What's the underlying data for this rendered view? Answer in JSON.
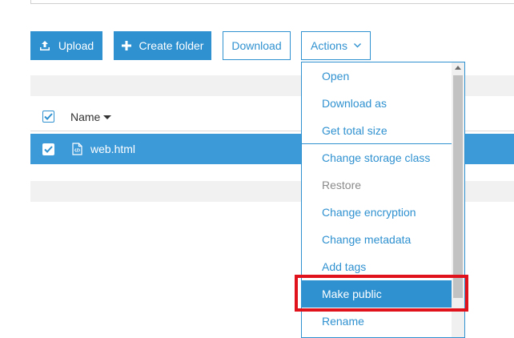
{
  "toolbar": {
    "upload_label": "Upload",
    "create_folder_label": "Create folder",
    "download_label": "Download",
    "actions_label": "Actions"
  },
  "table": {
    "name_header": "Name",
    "rows": [
      {
        "name": "web.html",
        "selected": true
      }
    ]
  },
  "actions_menu": {
    "items": [
      {
        "label": "Open"
      },
      {
        "label": "Download as"
      },
      {
        "label": "Get total size"
      },
      {
        "label": "Change storage class"
      },
      {
        "label": "Restore",
        "disabled": true
      },
      {
        "label": "Change encryption"
      },
      {
        "label": "Change metadata"
      },
      {
        "label": "Add tags"
      },
      {
        "label": "Make public",
        "highlighted": true
      },
      {
        "label": "Rename"
      }
    ]
  },
  "colors": {
    "accent": "#2f91d0",
    "selected_row": "#3d9ad8",
    "annotation": "#e0131c"
  },
  "icons": {
    "upload": "upload-icon",
    "create_folder": "plus-icon",
    "actions": "chevron-down-icon",
    "file": "html-file-icon",
    "sort": "caret-down-icon"
  }
}
